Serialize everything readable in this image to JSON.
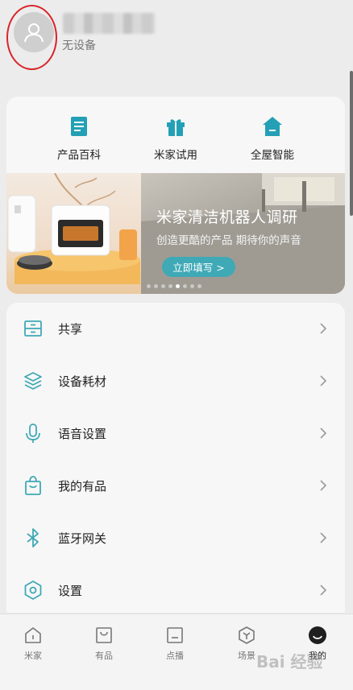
{
  "profile": {
    "device_status": "无设备"
  },
  "quick_actions": [
    {
      "label": "产品百科",
      "icon": "encyclopedia-icon"
    },
    {
      "label": "米家试用",
      "icon": "gift-trial-icon"
    },
    {
      "label": "全屋智能",
      "icon": "smart-home-icon"
    }
  ],
  "banner": {
    "title": "米家清洁机器人调研",
    "subtitle": "创造更酷的产品 期待你的声音",
    "button_label": "立即填写 >",
    "slide_count": 8,
    "active_slide": 4
  },
  "menu": [
    {
      "label": "共享",
      "icon": "share-icon"
    },
    {
      "label": "设备耗材",
      "icon": "consumables-icon"
    },
    {
      "label": "语音设置",
      "icon": "microphone-icon"
    },
    {
      "label": "我的有品",
      "icon": "shopping-bag-icon"
    },
    {
      "label": "蓝牙网关",
      "icon": "bluetooth-icon"
    },
    {
      "label": "设置",
      "icon": "settings-icon"
    }
  ],
  "nav": [
    {
      "label": "米家",
      "icon": "home-icon"
    },
    {
      "label": "有品",
      "icon": "store-icon"
    },
    {
      "label": "点播",
      "icon": "video-icon"
    },
    {
      "label": "场景",
      "icon": "scene-icon"
    },
    {
      "label": "我的",
      "icon": "profile-icon",
      "active": true
    }
  ],
  "colors": {
    "accent": "#3fa9b6",
    "annotation": "#d9242a",
    "background": "#ececec"
  },
  "watermark": "Bai 经验"
}
